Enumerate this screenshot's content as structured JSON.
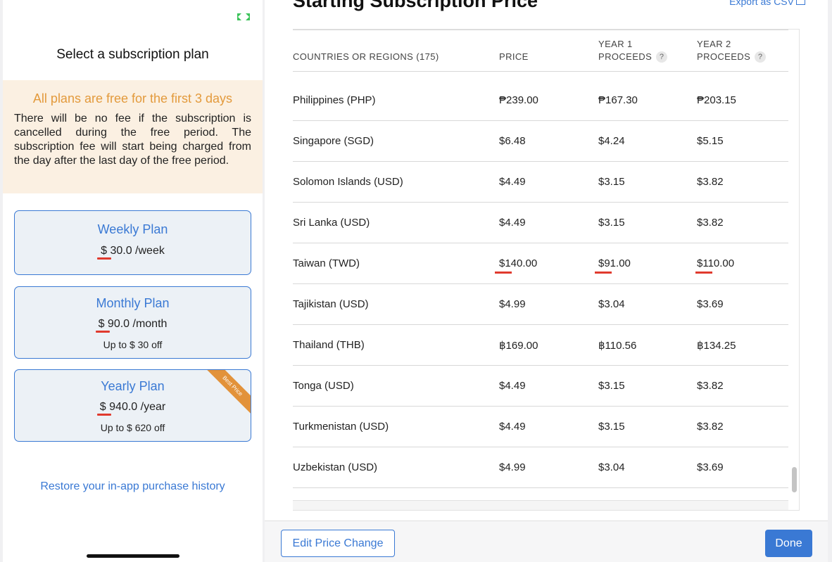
{
  "left_panel": {
    "title": "Select a subscription plan",
    "trial": {
      "title": "All plans are free for the first 3 days",
      "text": "There will be no fee if the subscription is cancelled during the free period. The subscription fee will start being charged from the day after the last day of the free period."
    },
    "plans": [
      {
        "name": "Weekly Plan",
        "price": "$ 30.0 /week",
        "discount": ""
      },
      {
        "name": "Monthly Plan",
        "price": "$ 90.0 /month",
        "discount": "Up to $ 30 off"
      },
      {
        "name": "Yearly Plan",
        "price": "$ 940.0 /year",
        "discount": "Up to $ 620 off",
        "badge": "Best Price"
      }
    ],
    "restore_link": "Restore your in-app purchase history",
    "accent_color": "#3a79d4",
    "highlight_color": "#e39a3c",
    "underline_color": "#e03a2e"
  },
  "right_panel": {
    "heading": "Starting Subscription Price",
    "export_label": "Export as CSV",
    "table": {
      "headers": {
        "country": "COUNTRIES OR REGIONS (175)",
        "price": "PRICE",
        "year1_line1": "YEAR 1",
        "year1_line2": "PROCEEDS",
        "year2_line1": "YEAR 2",
        "year2_line2": "PROCEEDS",
        "help": "?"
      },
      "rows": [
        {
          "country": "Philippines (PHP)",
          "price": "₱239.00",
          "year1": "₱167.30",
          "year2": "₱203.15"
        },
        {
          "country": "Singapore (SGD)",
          "price": "$6.48",
          "year1": "$4.24",
          "year2": "$5.15"
        },
        {
          "country": "Solomon Islands (USD)",
          "price": "$4.49",
          "year1": "$3.15",
          "year2": "$3.82"
        },
        {
          "country": "Sri Lanka (USD)",
          "price": "$4.49",
          "year1": "$3.15",
          "year2": "$3.82"
        },
        {
          "country": "Taiwan (TWD)",
          "price": "$140.00",
          "year1": "$91.00",
          "year2": "$110.00"
        },
        {
          "country": "Tajikistan (USD)",
          "price": "$4.99",
          "year1": "$3.04",
          "year2": "$3.69"
        },
        {
          "country": "Thailand (THB)",
          "price": "฿169.00",
          "year1": "฿110.56",
          "year2": "฿134.25"
        },
        {
          "country": "Tonga (USD)",
          "price": "$4.49",
          "year1": "$3.15",
          "year2": "$3.82"
        },
        {
          "country": "Turkmenistan (USD)",
          "price": "$4.49",
          "year1": "$3.15",
          "year2": "$3.82"
        },
        {
          "country": "Uzbekistan (USD)",
          "price": "$4.99",
          "year1": "$3.04",
          "year2": "$3.69"
        }
      ]
    },
    "footer": {
      "edit_button": "Edit Price Change",
      "done_button": "Done"
    }
  }
}
